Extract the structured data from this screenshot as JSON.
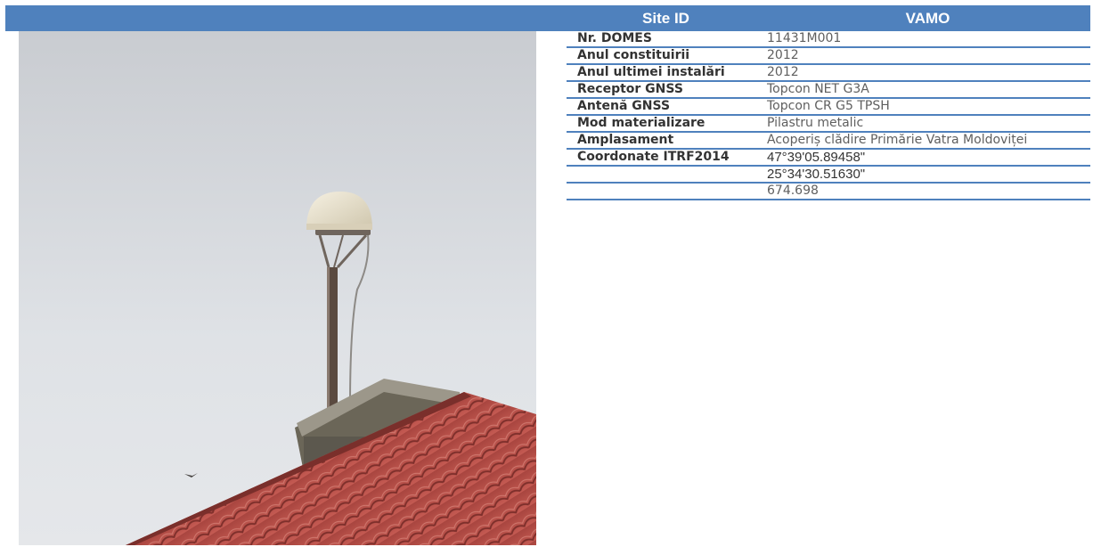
{
  "header": {
    "key_label": "Site ID",
    "value_label": "VAMO"
  },
  "rows": [
    {
      "label": "Nr. DOMES",
      "value": "11431M001"
    },
    {
      "label": "Anul constituirii",
      "value": "2012"
    },
    {
      "label": "Anul ultimei instalări",
      "value": "2012"
    },
    {
      "label": "Receptor GNSS",
      "value": "Topcon NET G3A"
    },
    {
      "label": "Antenă GNSS",
      "value": "Topcon CR G5 TPSH"
    },
    {
      "label": "Mod materializare",
      "value": "Pilastru metalic"
    },
    {
      "label": "Amplasament",
      "value": "Acoperiș clădire Primărie Vatra Moldoviței"
    },
    {
      "label": "Coordonate ITRF2014",
      "value": "47°39'05.89458\""
    },
    {
      "label": "",
      "value": "25°34'30.51630\""
    },
    {
      "label": "",
      "value": "674.698"
    }
  ],
  "colors": {
    "accent": "#4f81bd",
    "roof": "#b8504a",
    "sky": "#dcdfe3"
  }
}
